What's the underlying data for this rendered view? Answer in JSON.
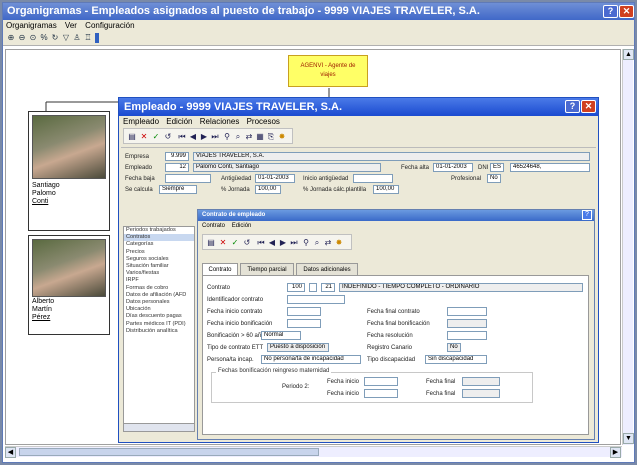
{
  "outer_window": {
    "title": "Organigramas - Empleados asignados al puesto de trabajo - 9999 VIAJES TRAVELER, S.A.",
    "help_button": "?",
    "close_button": "✕",
    "menu": [
      "Organigramas",
      "Ver",
      "Configuración"
    ]
  },
  "org_node": {
    "label_line1": "AGENVI - Agente de",
    "label_line2": "viajes"
  },
  "employees": [
    {
      "name_line1": "Santiago",
      "name_line2": "Palomo",
      "name_line3": "Conti"
    },
    {
      "name_line1": "Alberto",
      "name_line2": "Martín",
      "name_line3": "Pérez"
    }
  ],
  "employee_window": {
    "title": "Empleado - 9999 VIAJES TRAVELER, S.A.",
    "help_button": "?",
    "close_button": "✕",
    "menu": [
      "Empleado",
      "Edición",
      "Relaciones",
      "Procesos"
    ],
    "fields": {
      "empresa_label": "Empresa",
      "empresa_code": "9.999",
      "empresa_name": "VIAJES TRAVELER, S.A.",
      "empleado_label": "Empleado",
      "empleado_code": "12",
      "empleado_name": "Palomo Conti, Santiago",
      "fecha_baja_label": "Fecha baja",
      "antiguedad_label": "Antigüedad",
      "antiguedad_value": "01-01-2003",
      "inicio_antig_label": "Inicio antigüedad",
      "se_calcula_label": "Se calcula",
      "se_calcula_value": "Siempre",
      "pct_jornada_label": "% Jornada",
      "pct_jornada_value": "100,00",
      "pct_jornada_plant_label": "% Jornada cálc.plantilla",
      "pct_jornada_plant_value": "100,00",
      "fecha_alta_label": "Fecha alta",
      "fecha_alta_value": "01-01-2003",
      "dni_label": "DNI",
      "dni_type": "ES",
      "dni_value": "46524648,",
      "profesional_label": "Profesional",
      "profesional_value": "No"
    },
    "nav_items": [
      "Periodos trabajados",
      "Contratos",
      "Categorías",
      "Precios",
      "Seguros sociales",
      "Situación familiar",
      "Varios/fiestas",
      "IRPF",
      "Formas de cobro",
      "Datos de afiliación (AFD",
      "Datos personales",
      "Ubicación",
      "Días descuento pagas",
      "Partes médicos IT (PDI)",
      "Distribución analítica"
    ],
    "nav_selected": 1
  },
  "contrato_window": {
    "title": "Contrato de empleado",
    "help_button": "?",
    "menu": [
      "Contrato",
      "Edición"
    ],
    "tabs": [
      "Contrato",
      "Tiempo parcial",
      "Datos adicionales"
    ],
    "fields": {
      "contrato_label": "Contrato",
      "contrato_code": "100",
      "contrato_num": "21",
      "contrato_desc": "INDEFINIDO - TIEMPO COMPLETO - ORDINARIO",
      "identificador_label": "Identificador contrato",
      "fecha_inicio_label": "Fecha inicio contrato",
      "fecha_final_label": "Fecha final contrato",
      "fecha_inicio_bonif_label": "Fecha inicio bonificación",
      "fecha_final_bonif_label": "Fecha final bonificación",
      "bonif_60_label": "Bonificación > 60 años",
      "bonif_60_value": "Normal",
      "fecha_resolucion_label": "Fecha resolución",
      "tipo_ett_label": "Tipo de contrato ETT",
      "tipo_ett_value": "Puesto a disposición",
      "registro_canario_label": "Registro Canario",
      "registro_canario_value": "No",
      "persona_incap_label": "Persona/ta incap.",
      "persona_incap_value": "No persona/ta de incapacidad",
      "tipo_discap_label": "Tipo discapacidad",
      "tipo_discap_value": "Sin discapacidad",
      "group_title": "Fechas bonificación reingreso maternidad",
      "periodo_label": "Periodo 2:",
      "fecha_inicio_short": "Fecha inicio",
      "fecha_final_short": "Fecha final"
    }
  }
}
